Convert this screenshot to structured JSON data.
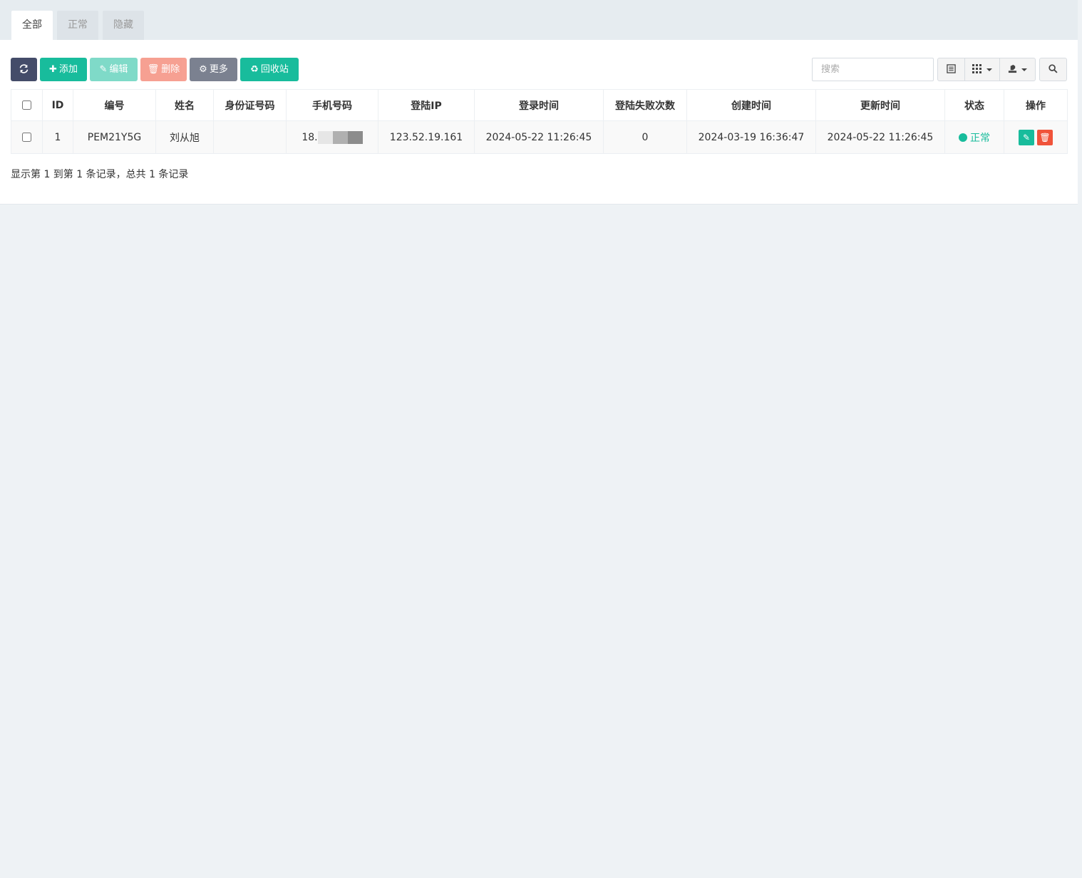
{
  "tabs": [
    {
      "label": "全部",
      "active": true
    },
    {
      "label": "正常",
      "active": false
    },
    {
      "label": "隐藏",
      "active": false
    }
  ],
  "toolbar": {
    "refresh_icon": "refresh-icon",
    "add_label": "添加",
    "edit_label": "编辑",
    "delete_label": "删除",
    "more_label": "更多",
    "recycle_label": "回收站",
    "search_placeholder": "搜索"
  },
  "table": {
    "columns": [
      "ID",
      "编号",
      "姓名",
      "身份证号码",
      "手机号码",
      "登陆IP",
      "登录时间",
      "登陆失败次数",
      "创建时间",
      "更新时间",
      "状态",
      "操作"
    ],
    "rows": [
      {
        "id": "1",
        "code": "PEM21Y5G",
        "name": "刘从旭",
        "id_card": "",
        "phone": "18.",
        "login_ip": "123.52.19.161",
        "login_time": "2024-05-22 11:26:45",
        "login_failures": "0",
        "created_at": "2024-03-19 16:36:47",
        "updated_at": "2024-05-22 11:26:45",
        "status": "正常"
      }
    ]
  },
  "pagination": {
    "summary": "显示第 1 到第 1 条记录，总共 1 条记录"
  },
  "colors": {
    "primary": "#18bc9c",
    "danger": "#f0533a",
    "dark": "#444c69",
    "gray": "#7b8190"
  }
}
